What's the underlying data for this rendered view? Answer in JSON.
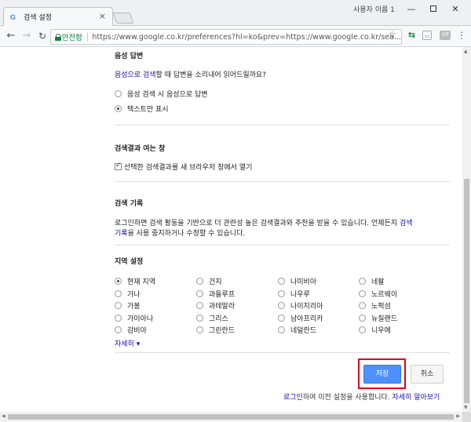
{
  "browser": {
    "tab_title": "검색 설정",
    "tab_close": "×",
    "user_label": "사용자 이름 1",
    "secure_label": "안전함",
    "url": "https://www.google.co.kr/preferences?hl=ko&prev=https://www.google.co.kr/sea...",
    "ext_2": "▭",
    "ext_3": "Off",
    "menu": "⋮"
  },
  "voice": {
    "title": "음성 답변",
    "desc_link": "음성으로 검색",
    "desc_rest": "할 때 답변을 소리내어 읽어드릴까요?",
    "options": [
      "음성 검색 시 음성으로 답변",
      "텍스트만 표시"
    ],
    "selected": 1
  },
  "results_window": {
    "title": "검색결과 여는 창",
    "checkbox_label": "선택한 검색결과를 새 브라우저 창에서 열기",
    "checked": true
  },
  "history": {
    "title": "검색 기록",
    "text_1": "로그인하면 검색 활동을 기반으로 더 관련성 높은 검색결과와 추천을 받을 수 있습니다. 언제든지 ",
    "link_1": "검색",
    "link_2": "기록",
    "text_2": "을 사용 중지하거나 수정할 수 있습니다."
  },
  "region": {
    "title": "지역 설정",
    "columns": [
      [
        "현재 지역",
        "가나",
        "가봉",
        "가이아나",
        "감비아"
      ],
      [
        "건지",
        "과들루프",
        "과테말라",
        "그리스",
        "그린란드"
      ],
      [
        "나미비아",
        "나우루",
        "나이지리아",
        "남아프리카",
        "네덜란드"
      ],
      [
        "네팔",
        "노르웨이",
        "노퍽섬",
        "뉴질랜드",
        "니우에"
      ]
    ],
    "selected": "현재 지역",
    "more": "자세히 ▾"
  },
  "actions": {
    "save": "저장",
    "cancel": "취소"
  },
  "footer": {
    "login_link": "로그인",
    "text": "하여 이전 설정을 사용합니다. ",
    "learn_more": "자세히 알아보기"
  }
}
